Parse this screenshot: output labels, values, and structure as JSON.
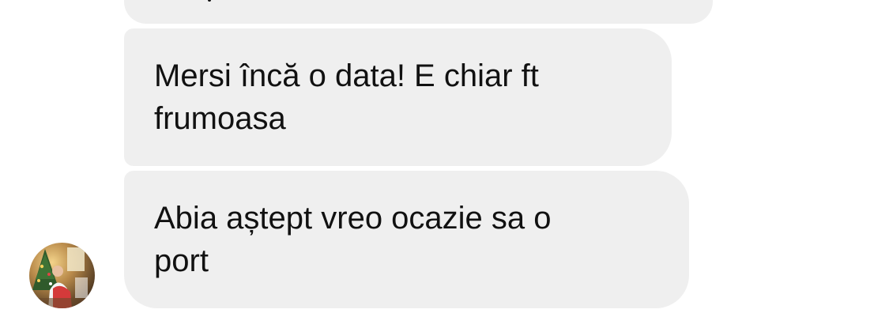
{
  "conversation": {
    "messages": [
      {
        "text": ""
      },
      {
        "text": "Mersi încă o data! E chiar ft\nfrumoasa"
      },
      {
        "text": "Abia aștept vreo ocazie sa o\nport"
      }
    ],
    "sender": {
      "avatar_icon": "profile-photo",
      "colors": {
        "bubble": "#efefef",
        "text": "#111111",
        "background": "#ffffff"
      }
    }
  }
}
